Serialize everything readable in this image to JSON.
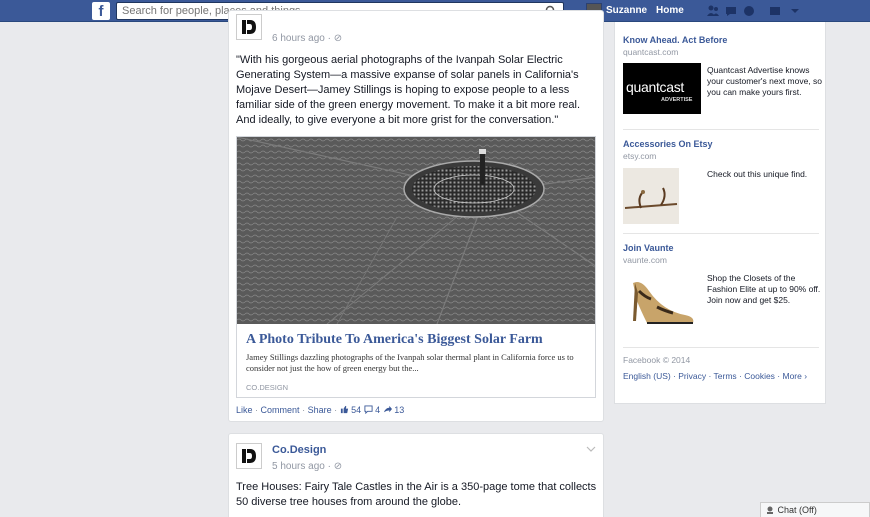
{
  "topbar": {
    "logo": "f",
    "search_placeholder": "Search for people, places and things",
    "user_name": "Suzanne",
    "home_label": "Home"
  },
  "post1": {
    "time": "6 hours ago · ⊘",
    "text": "\"With his gorgeous aerial photographs of the Ivanpah Solar Electric Generating System—a massive expanse of solar panels in California's Mojave Desert—Jamey Stillings is hoping to expose people to a less familiar side of the green energy movement. To make it a bit more real. And ideally, to give everyone a bit more grist for the conversation.\"",
    "link_title": "A Photo Tribute To America's Biggest Solar Farm",
    "link_desc": "Jamey Stillings dazzling photographs of the Ivanpah solar thermal plant in California force us to consider not just the how of green energy but the...",
    "link_source": "CO.DESIGN",
    "action_like": "Like",
    "action_comment": "Comment",
    "action_share": "Share",
    "likes": "54",
    "comments": "4",
    "shares": "13"
  },
  "post2": {
    "page_name": "Co.Design",
    "time": "5 hours ago · ⊘",
    "text": "Tree Houses: Fairy Tale Castles in the Air is a 350-page tome that collects 50 diverse tree houses from around the globe."
  },
  "ads": [
    {
      "title": "Know Ahead. Act Before",
      "domain": "quantcast.com",
      "image_text": "quantcast",
      "image_subtext": "ADVERTISE",
      "text": "Quantcast Advertise knows your customer's next move, so you can make yours first."
    },
    {
      "title": "Accessories On Etsy",
      "domain": "etsy.com",
      "text": "Check out this unique find."
    },
    {
      "title": "Join Vaunte",
      "domain": "vaunte.com",
      "text": "Shop the Closets of the Fashion Elite at up to 90% off. Join now and get $25."
    }
  ],
  "footer": {
    "copyright": "Facebook © 2014",
    "links": "English (US) · Privacy · Terms · Cookies · More ›"
  },
  "chat": {
    "label": "Chat (Off)"
  }
}
